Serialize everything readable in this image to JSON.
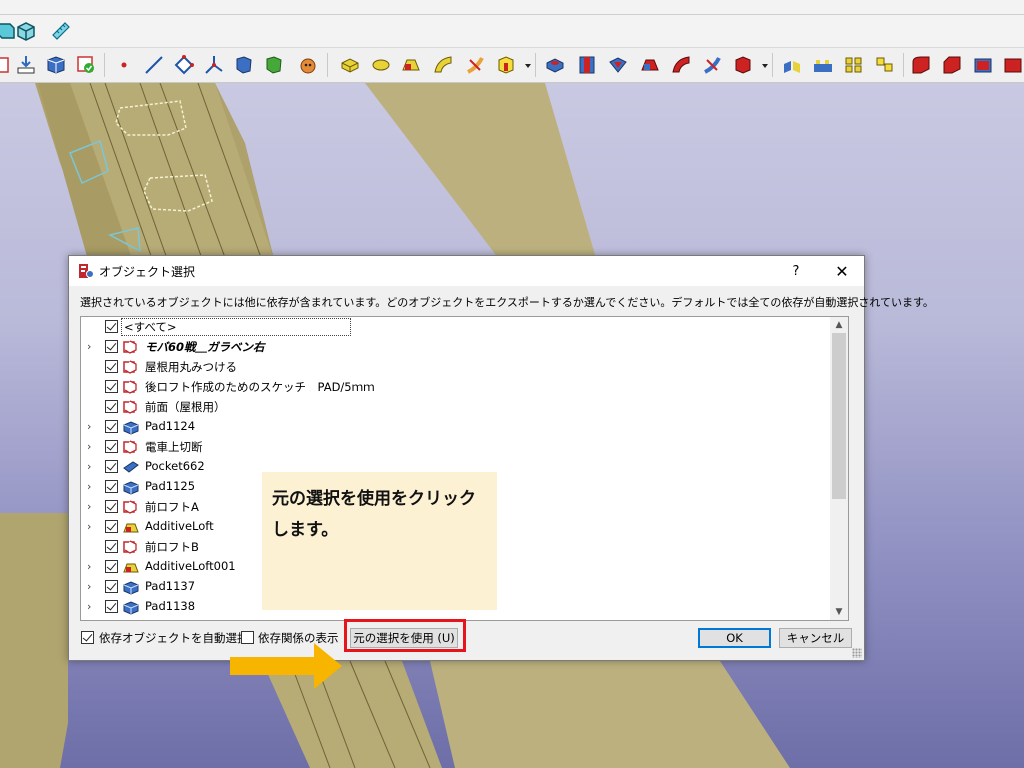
{
  "dialog": {
    "title": "オブジェクト選択",
    "help": "?",
    "close": "✕",
    "instruction": "選択されているオブジェクトには他に依存が含まれています。どのオブジェクトをエクスポートするか選んでください。デフォルトでは全ての依存が自動選択されています。",
    "tree": {
      "all_label": "<すべて>",
      "items": [
        {
          "label": "モバ60戦＿ガラベン右",
          "icon": "body-icon",
          "expandable": true,
          "italic": true
        },
        {
          "label": "屋根用丸みつける",
          "icon": "sketch-icon",
          "expandable": false,
          "italic": false
        },
        {
          "label": "後ロフト作成のためのスケッチ　PAD/5ｍｍ",
          "icon": "sketch-icon",
          "expandable": false,
          "italic": false
        },
        {
          "label": "前面（屋根用）",
          "icon": "sketch-icon",
          "expandable": false,
          "italic": false
        },
        {
          "label": "Pad1124",
          "icon": "pad-icon",
          "expandable": true,
          "italic": false
        },
        {
          "label": "電車上切断",
          "icon": "sketch-icon",
          "expandable": true,
          "italic": false
        },
        {
          "label": "Pocket662",
          "icon": "pocket-icon",
          "expandable": true,
          "italic": false
        },
        {
          "label": "Pad1125",
          "icon": "pad-icon",
          "expandable": true,
          "italic": false
        },
        {
          "label": "前ロフトA",
          "icon": "sketch-icon",
          "expandable": true,
          "italic": false
        },
        {
          "label": "AdditiveLoft",
          "icon": "loft-icon",
          "expandable": true,
          "italic": false
        },
        {
          "label": "前ロフトB",
          "icon": "sketch-icon",
          "expandable": false,
          "italic": false
        },
        {
          "label": "AdditiveLoft001",
          "icon": "loft-icon",
          "expandable": true,
          "italic": false
        },
        {
          "label": "Pad1137",
          "icon": "pad-icon",
          "expandable": true,
          "italic": false
        },
        {
          "label": "Pad1138",
          "icon": "pad-icon",
          "expandable": true,
          "italic": false
        }
      ]
    },
    "auto_select_label": "依存オブジェクトを自動選択",
    "show_deps_label": "依存関係の表示",
    "use_original_label": "元の選択を使用 (U)",
    "ok_label": "OK",
    "cancel_label": "キャンセル"
  },
  "annotation": {
    "callout_text": "元の選択を使用をクリックします。",
    "highlight_color": "#e8141c",
    "arrow_color": "#f7b500",
    "callout_bg": "#fdf1d3"
  },
  "colors": {
    "model_body": "#b4a873",
    "viewport_top": "#c9c9e2",
    "viewport_bottom": "#6e6ea8"
  }
}
